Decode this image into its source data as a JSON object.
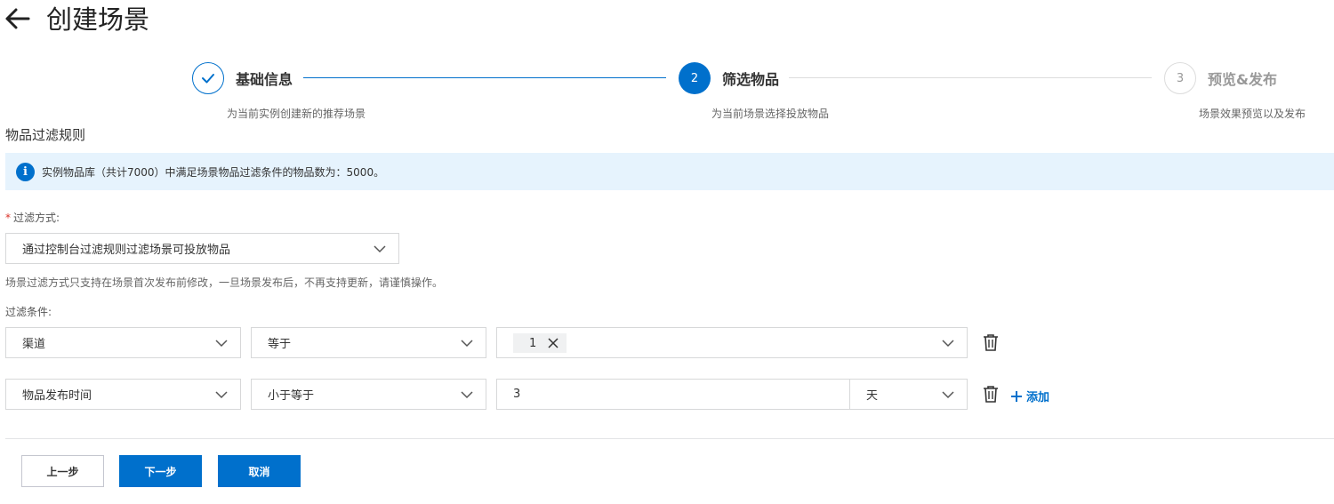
{
  "header": {
    "title": "创建场景"
  },
  "steps": [
    {
      "number": "",
      "title": "基础信息",
      "desc": "为当前实例创建新的推荐场景",
      "state": "done"
    },
    {
      "number": "2",
      "title": "筛选物品",
      "desc": "为当前场景选择投放物品",
      "state": "active"
    },
    {
      "number": "3",
      "title": "预览&发布",
      "desc": "场景效果预览以及发布",
      "state": "todo"
    }
  ],
  "section": {
    "title": "物品过滤规则"
  },
  "info": {
    "text": "实例物品库（共计7000）中满足场景物品过滤条件的物品数为：5000。"
  },
  "filter_method": {
    "label": "过滤方式:",
    "required_mark": "*",
    "value": "通过控制台过滤规则过滤场景可投放物品",
    "hint": "场景过滤方式只支持在场景首次发布前修改，一旦场景发布后，不再支持更新，请谨慎操作。"
  },
  "conditions": {
    "label": "过滤条件:",
    "rows": [
      {
        "field": "渠道",
        "operator": "等于",
        "tag": "1"
      },
      {
        "field": "物品发布时间",
        "operator": "小于等于",
        "value": "3",
        "unit": "天"
      }
    ],
    "add_label": "添加"
  },
  "buttons": {
    "prev": "上一步",
    "next": "下一步",
    "cancel": "取消"
  },
  "colors": {
    "primary": "#0070cc",
    "info_bg": "#e6f3fd",
    "required": "#d93026"
  }
}
